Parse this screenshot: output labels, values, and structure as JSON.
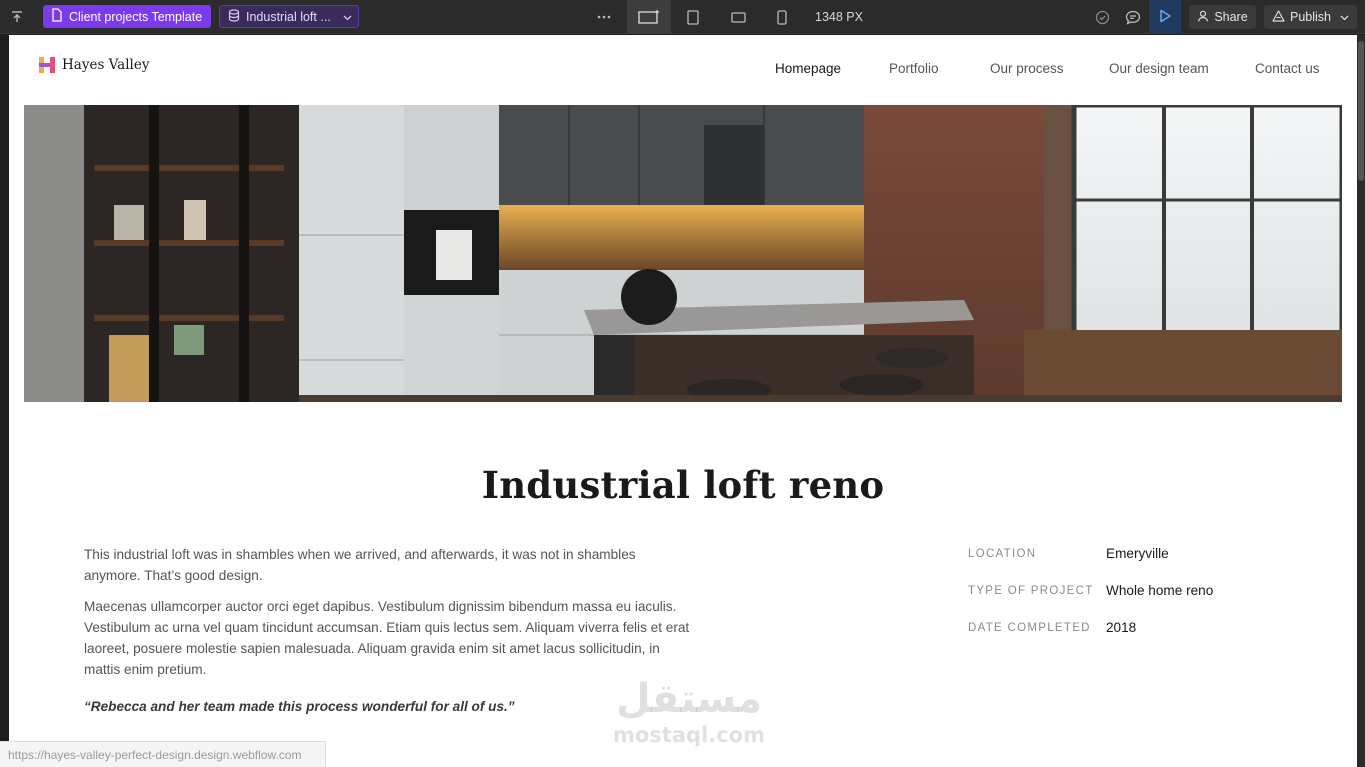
{
  "editor": {
    "template_label": "Client projects Template",
    "cms_item_label": "Industrial loft ...",
    "width_readout": "1348 PX",
    "share_label": "Share",
    "publish_label": "Publish",
    "accent_color": "#7c3aed"
  },
  "site": {
    "brand": "Hayes Valley",
    "nav": [
      {
        "label": "Homepage",
        "active": true
      },
      {
        "label": "Portfolio",
        "active": false
      },
      {
        "label": "Our process",
        "active": false
      },
      {
        "label": "Our design team",
        "active": false
      },
      {
        "label": "Contact us",
        "active": false
      }
    ]
  },
  "project": {
    "title": "Industrial loft reno",
    "paragraphs": [
      "This industrial loft was in shambles when we arrived, and afterwards, it was not in shambles anymore. That’s good design.",
      "Maecenas ullamcorper auctor orci eget dapibus. Vestibulum dignissim bibendum massa eu iaculis. Vestibulum ac urna vel quam tincidunt accumsan. Etiam quis lectus sem. Aliquam viverra felis et erat laoreet, posuere molestie sapien malesuada. Aliquam gravida enim sit amet lacus sollicitudin, in mattis enim pretium."
    ],
    "quote": "“Rebecca and her team made this process wonderful for all of us.”",
    "meta": [
      {
        "label": "LOCATION",
        "value": "Emeryville"
      },
      {
        "label": "TYPE OF PROJECT",
        "value": "Whole home reno"
      },
      {
        "label": "DATE COMPLETED",
        "value": "2018"
      }
    ]
  },
  "watermark": {
    "arabic": "مستقل",
    "latin": "mostaql.com"
  },
  "status_url": "https://hayes-valley-perfect-design.design.webflow.com"
}
